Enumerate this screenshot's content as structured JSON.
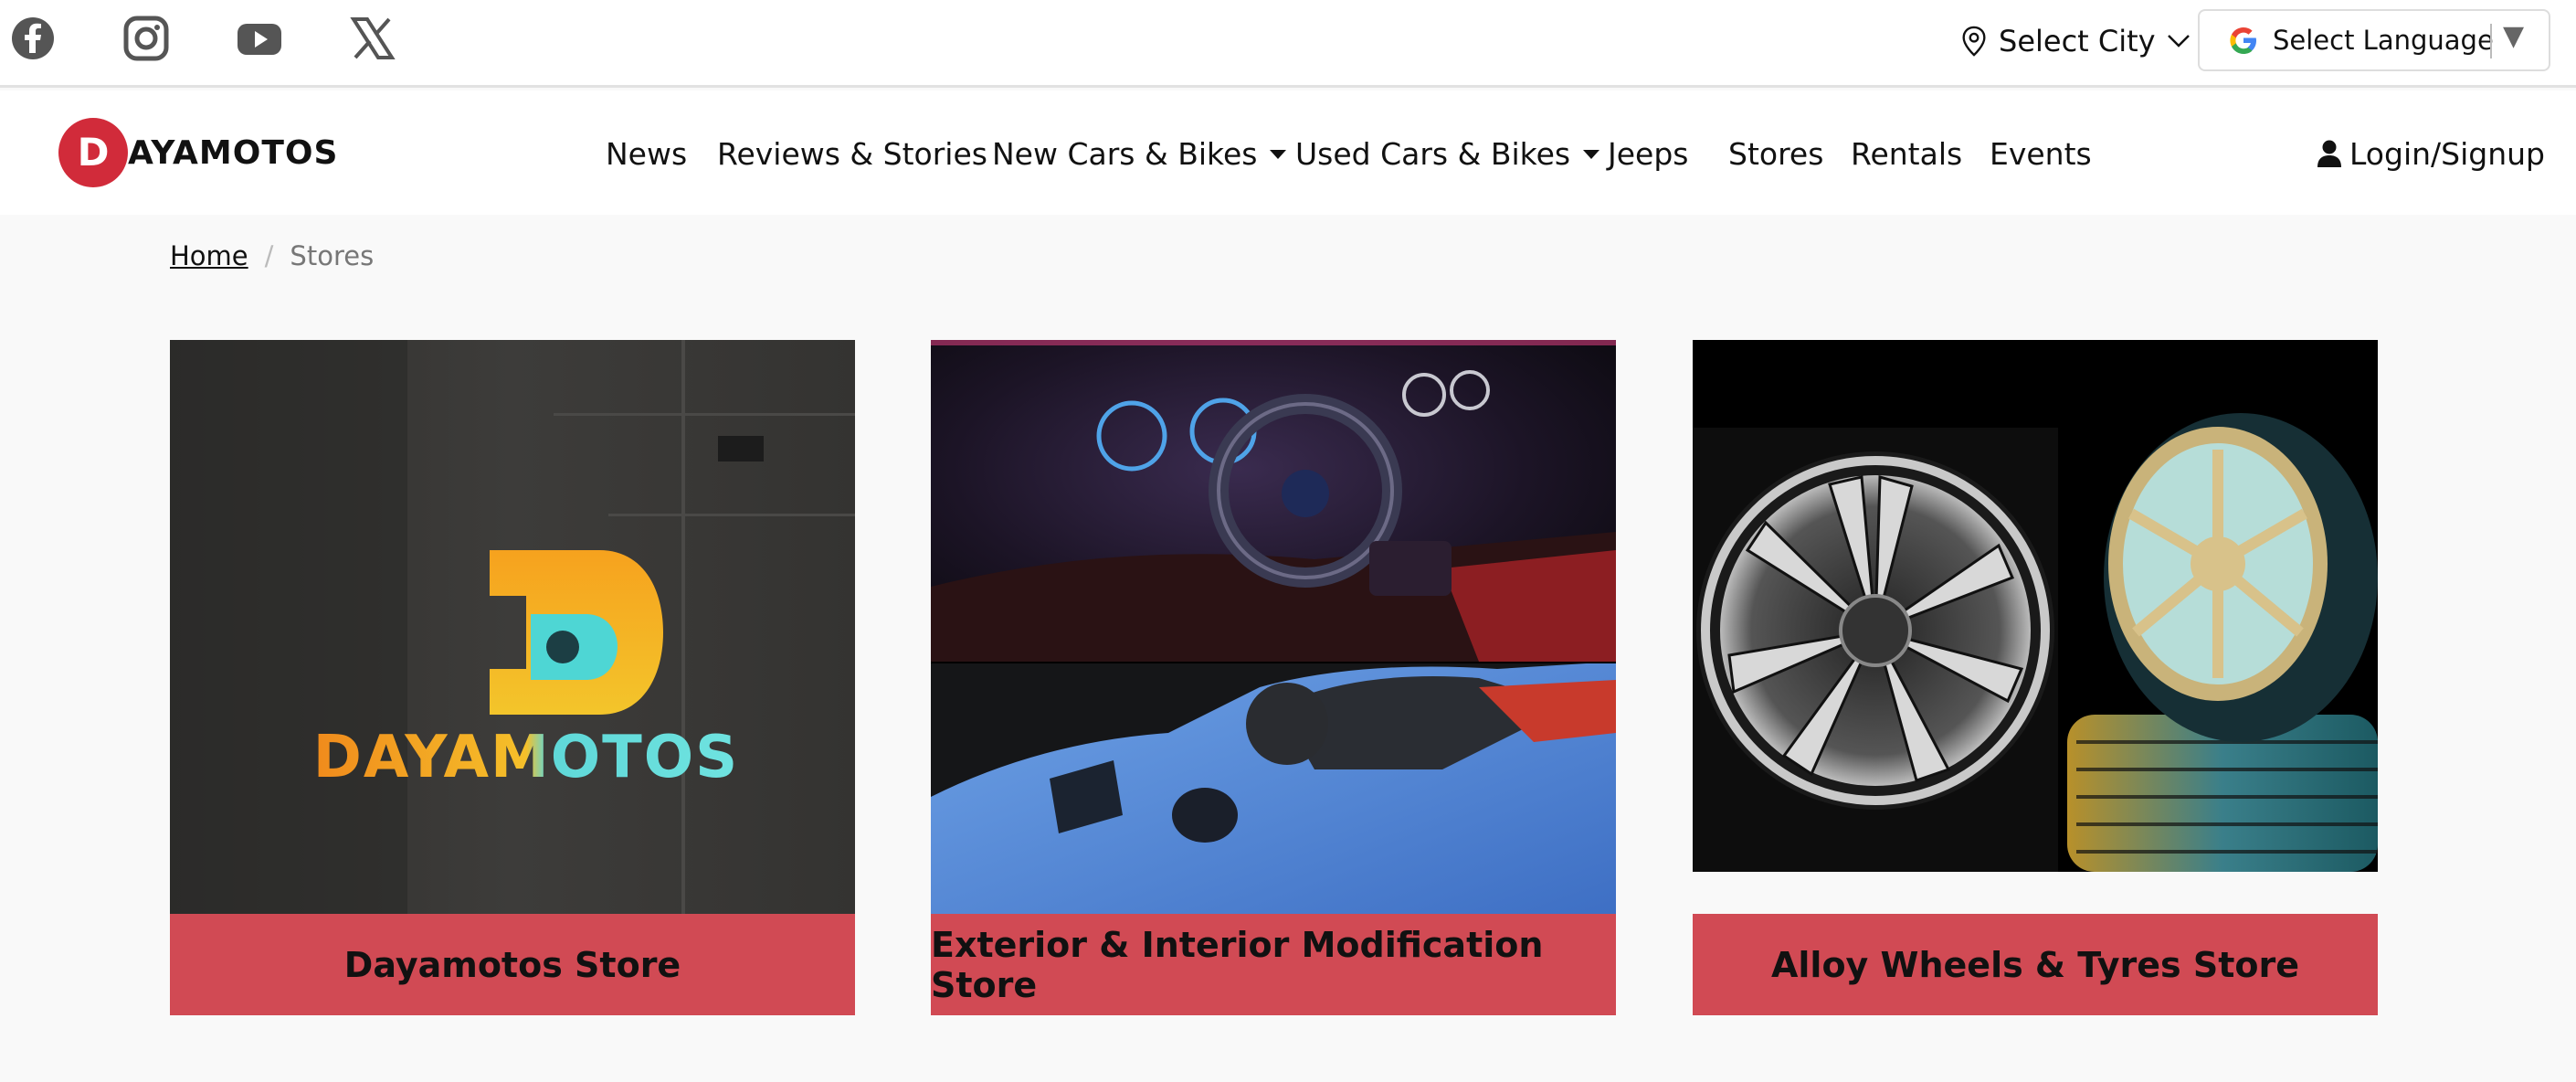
{
  "social": {
    "icons": [
      "facebook-icon",
      "instagram-icon",
      "youtube-icon",
      "x-twitter-icon"
    ]
  },
  "utility": {
    "city_label": "Select City",
    "language_label": "Select Language",
    "language_arrow": "▼"
  },
  "brand": {
    "name": "AYAMOTOS",
    "logo_letter": "D",
    "accent": "#d14a54"
  },
  "nav": {
    "items": [
      {
        "label": "News"
      },
      {
        "label": "Reviews & Stories"
      },
      {
        "label": "New Cars & Bikes"
      },
      {
        "label": "Used Cars & Bikes"
      },
      {
        "label": "Jeeps"
      },
      {
        "label": "Stores"
      },
      {
        "label": "Rentals"
      },
      {
        "label": "Events"
      }
    ],
    "login_label": "Login/Signup"
  },
  "breadcrumb": {
    "home": "Home",
    "separator": "/",
    "current": "Stores"
  },
  "stores": [
    {
      "title": "Dayamotos Store",
      "image_text": "DAYAMOTOS"
    },
    {
      "title": "Exterior & Interior Modification Store"
    },
    {
      "title": "Alloy Wheels & Tyres Store"
    }
  ],
  "colors": {
    "card_title_bg": "#d14a54",
    "page_bg": "#f9f9f9"
  }
}
